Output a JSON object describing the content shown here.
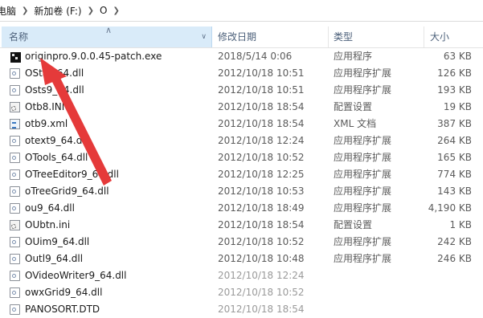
{
  "breadcrumb": {
    "items": [
      "电脑",
      "新加卷 (F:)",
      "O"
    ]
  },
  "columns": {
    "name": "名称",
    "date": "修改日期",
    "type": "类型",
    "size": "大小"
  },
  "files": [
    {
      "name": "originpro.9.0.0.45-patch.exe",
      "date": "2018/5/14 0:06",
      "type": "应用程序",
      "size": "63 KB",
      "icon": "exe"
    },
    {
      "name": "OStat_64.dll",
      "date": "2012/10/18 10:51",
      "type": "应用程序扩展",
      "size": "126 KB",
      "icon": "dll"
    },
    {
      "name": "Osts9_64.dll",
      "date": "2012/10/18 10:51",
      "type": "应用程序扩展",
      "size": "193 KB",
      "icon": "dll"
    },
    {
      "name": "Otb8.INI",
      "date": "2012/10/18 18:54",
      "type": "配置设置",
      "size": "19 KB",
      "icon": "ini"
    },
    {
      "name": "otb9.xml",
      "date": "2012/10/18 18:54",
      "type": "XML 文档",
      "size": "387 KB",
      "icon": "xml"
    },
    {
      "name": "otext9_64.dll",
      "date": "2012/10/18 12:24",
      "type": "应用程序扩展",
      "size": "264 KB",
      "icon": "dll"
    },
    {
      "name": "OTools_64.dll",
      "date": "2012/10/18 10:52",
      "type": "应用程序扩展",
      "size": "165 KB",
      "icon": "dll"
    },
    {
      "name": "OTreeEditor9_64.dll",
      "date": "2012/10/18 12:25",
      "type": "应用程序扩展",
      "size": "774 KB",
      "icon": "dll"
    },
    {
      "name": "oTreeGrid9_64.dll",
      "date": "2012/10/18 10:53",
      "type": "应用程序扩展",
      "size": "143 KB",
      "icon": "dll"
    },
    {
      "name": "ou9_64.dll",
      "date": "2012/10/18 18:49",
      "type": "应用程序扩展",
      "size": "4,190 KB",
      "icon": "dll"
    },
    {
      "name": "OUbtn.ini",
      "date": "2012/10/18 18:54",
      "type": "配置设置",
      "size": "1 KB",
      "icon": "ini"
    },
    {
      "name": "OUim9_64.dll",
      "date": "2012/10/18 10:52",
      "type": "应用程序扩展",
      "size": "242 KB",
      "icon": "dll"
    },
    {
      "name": "Outl9_64.dll",
      "date": "2012/10/18 10:48",
      "type": "应用程序扩展",
      "size": "246 KB",
      "icon": "dll"
    },
    {
      "name": "OVideoWriter9_64.dll",
      "date": "2012/10/18 12:24",
      "type": "",
      "size": "",
      "icon": "dll"
    },
    {
      "name": "owxGrid9_64.dll",
      "date": "2012/10/18 10:52",
      "type": "",
      "size": "",
      "icon": "dll"
    },
    {
      "name": "PANOSORT.DTD",
      "date": "2012/10/18 18:54",
      "type": "",
      "size": "",
      "icon": "dll"
    }
  ],
  "overlay": {
    "arrow_color": "#e53a3a"
  }
}
